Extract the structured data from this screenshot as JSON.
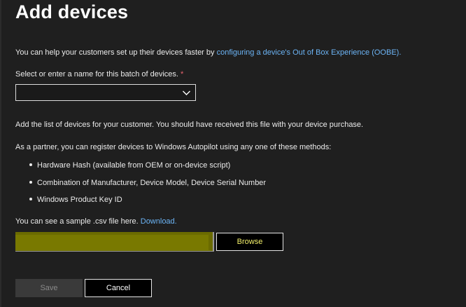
{
  "page": {
    "title": "Add devices"
  },
  "intro": {
    "text": "You can help your customers set up their devices faster by ",
    "link": "configuring a device's Out of Box Experience (OOBE)."
  },
  "batch": {
    "label": "Select or enter a name for this batch of devices. ",
    "required_marker": "*",
    "value": ""
  },
  "instructions": {
    "add_list": "Add the list of devices for your customer. You should have received this file with your device purchase.",
    "methods_intro": "As a partner, you can register devices to Windows Autopilot using any one of these methods:",
    "methods": [
      "Hardware Hash (available from OEM or on-device script)",
      "Combination of Manufacturer, Device Model, Device Serial Number",
      "Windows Product Key ID"
    ]
  },
  "sample": {
    "text": "You can see a sample .csv file here. ",
    "link": "Download."
  },
  "upload": {
    "file_value": "",
    "browse_label": "Browse"
  },
  "actions": {
    "save_label": "Save",
    "cancel_label": "Cancel"
  },
  "colors": {
    "background": "#1f1f1f",
    "link": "#6cb4f5",
    "required": "#e8636e",
    "file_highlight": "#797900",
    "browse_text": "#f2ef6a"
  }
}
